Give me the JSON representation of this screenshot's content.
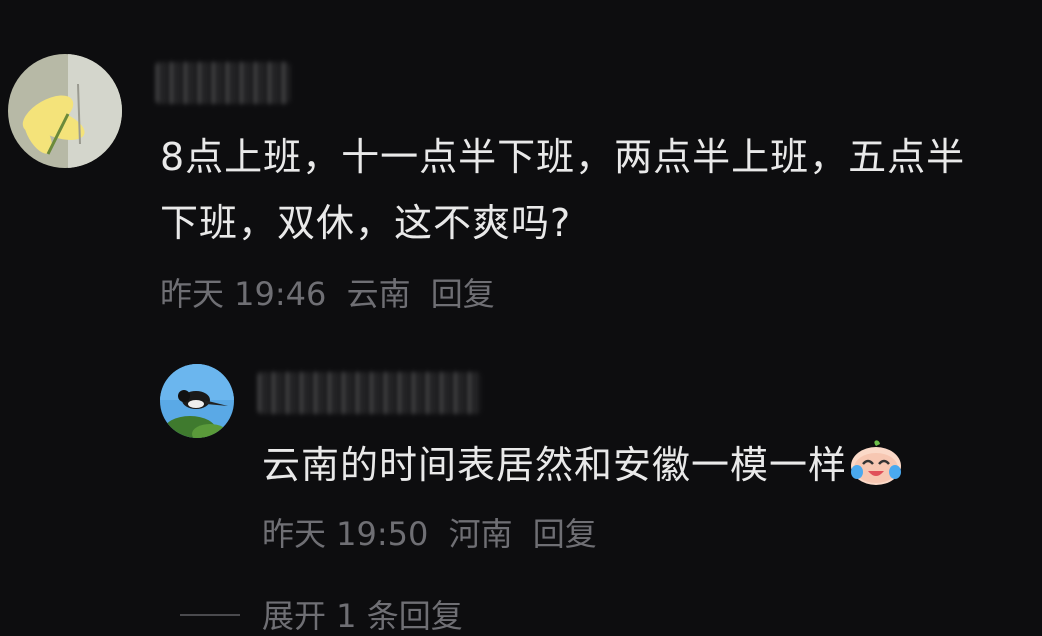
{
  "comment": {
    "text": "8点上班，十一点半下班，两点半上班，五点半下班，双休，这不爽吗?",
    "time": "昨天 19:46",
    "location": "云南",
    "reply_label": "回复"
  },
  "reply": {
    "text": "云南的时间表居然和安徽一模一样",
    "emoji": "crying-laughing-emoji",
    "time": "昨天 19:50",
    "location": "河南",
    "reply_label": "回复"
  },
  "expand": {
    "label": "展开 1 条回复"
  }
}
